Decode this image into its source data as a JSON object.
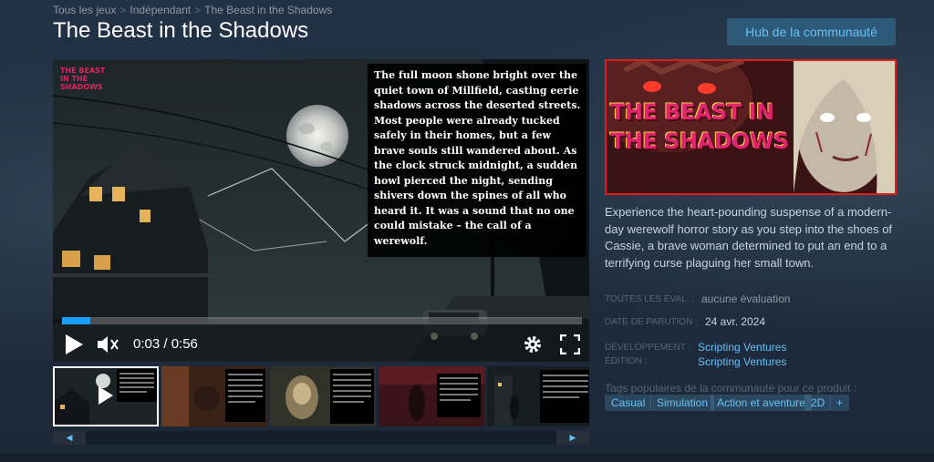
{
  "breadcrumb": {
    "all_games": "Tous les jeux",
    "independent": "Indépendant",
    "current": "The Beast in the Shadows"
  },
  "page_title": "The Beast in the Shadows",
  "hub_button": "Hub de la communauté",
  "player": {
    "overlay_logo": "THE BEAST IN THE SHADOWS",
    "story_text": "The full moon shone bright over the quiet town of Millfield, casting eerie shadows across the deserted streets. Most people were already tucked safely in their homes, but a few brave souls still wandered about. As the clock struck midnight, a sudden howl pierced the night, sending shivers down the spines of all who heard it. It was a sound that no one could mistake – the call of a werewolf.",
    "time": "0:03 / 0:56",
    "progress_fraction": 0.054
  },
  "capsule": {
    "title": "THE BEAST IN THE SHADOWS",
    "border_color": "#e21b1b"
  },
  "description": "Experience the heart-pounding suspense of a modern-day werewolf horror story as you step into the shoes of Cassie, a brave woman determined to put an end to a terrifying curse plaguing her small town.",
  "info": {
    "reviews_label": "TOUTES LES ÉVAL. :",
    "reviews_value": "aucune évaluation",
    "release_label": "DATE DE PARUTION :",
    "release_value": "24 avr. 2024",
    "developer_label": "DÉVELOPPEMENT :",
    "developer_value": "Scripting Ventures",
    "publisher_label": "ÉDITION :",
    "publisher_value": "Scripting Ventures"
  },
  "tags": {
    "label": "Tags populaires de la communauté pour ce produit :",
    "items": [
      "Casual",
      "Simulation",
      "Action et aventure",
      "2D",
      "+"
    ]
  },
  "colors": {
    "accent": "#67c1f5",
    "background": "#1b2838",
    "progress": "#1a9fff"
  }
}
